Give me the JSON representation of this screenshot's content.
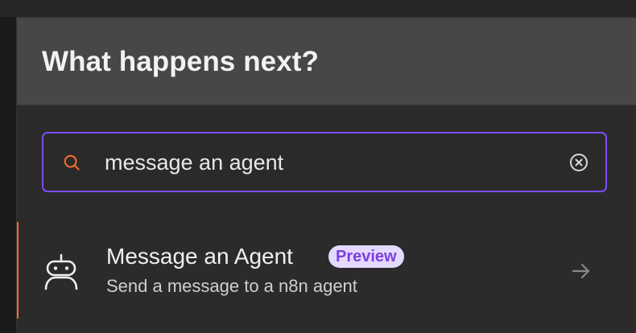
{
  "panel": {
    "title": "What happens next?"
  },
  "search": {
    "value": "message an agent",
    "search_icon": "search-icon",
    "clear_icon": "circle-x-icon"
  },
  "results": [
    {
      "title": "Message an Agent",
      "badge": "Preview",
      "description": "Send a message to a n8n agent",
      "icon": "robot-icon",
      "action_icon": "arrow-right-icon"
    }
  ],
  "colors": {
    "accent_border": "#7c4dff",
    "selection_accent": "#ff6d2d",
    "badge_bg": "#e4d9ff",
    "badge_text": "#7d3fe0",
    "search_icon": "#ff6d2d"
  }
}
